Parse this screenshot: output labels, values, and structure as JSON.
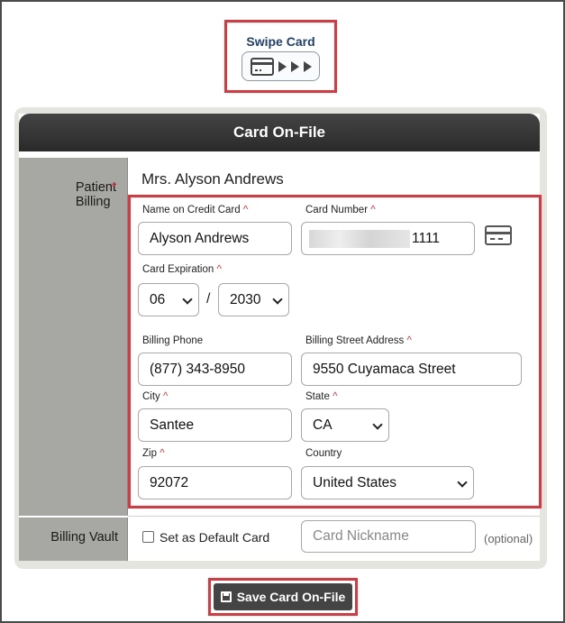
{
  "swipe": {
    "title": "Swipe Card",
    "icon": "card-swipe-icon"
  },
  "panel": {
    "title": "Card On-File",
    "patient_billing_label": "Patient Billing",
    "patient_name": "Mrs. Alyson Andrews",
    "billing_vault_label": "Billing Vault"
  },
  "form": {
    "name_label": "Name on Credit Card",
    "name_value": "Alyson Andrews",
    "card_number_label": "Card Number",
    "card_number_last4": "1111",
    "expiration_label": "Card Expiration",
    "exp_month": "06",
    "exp_separator": "/",
    "exp_year": "2030",
    "phone_label": "Billing Phone",
    "phone_value": "(877) 343-8950",
    "street_label": "Billing Street Address",
    "street_value": "9550 Cuyamaca Street",
    "city_label": "City",
    "city_value": "Santee",
    "state_label": "State",
    "state_value": "CA",
    "zip_label": "Zip",
    "zip_value": "92072",
    "country_label": "Country",
    "country_value": "United States",
    "required_mark": "^"
  },
  "vault": {
    "default_card_label": "Set as Default Card",
    "nickname_placeholder": "Card Nickname",
    "optional_text": "(optional)"
  },
  "save": {
    "label": "Save Card On-File"
  },
  "colors": {
    "highlight": "#e0353d",
    "header": "#333333",
    "accent_text": "#1f3f73"
  }
}
